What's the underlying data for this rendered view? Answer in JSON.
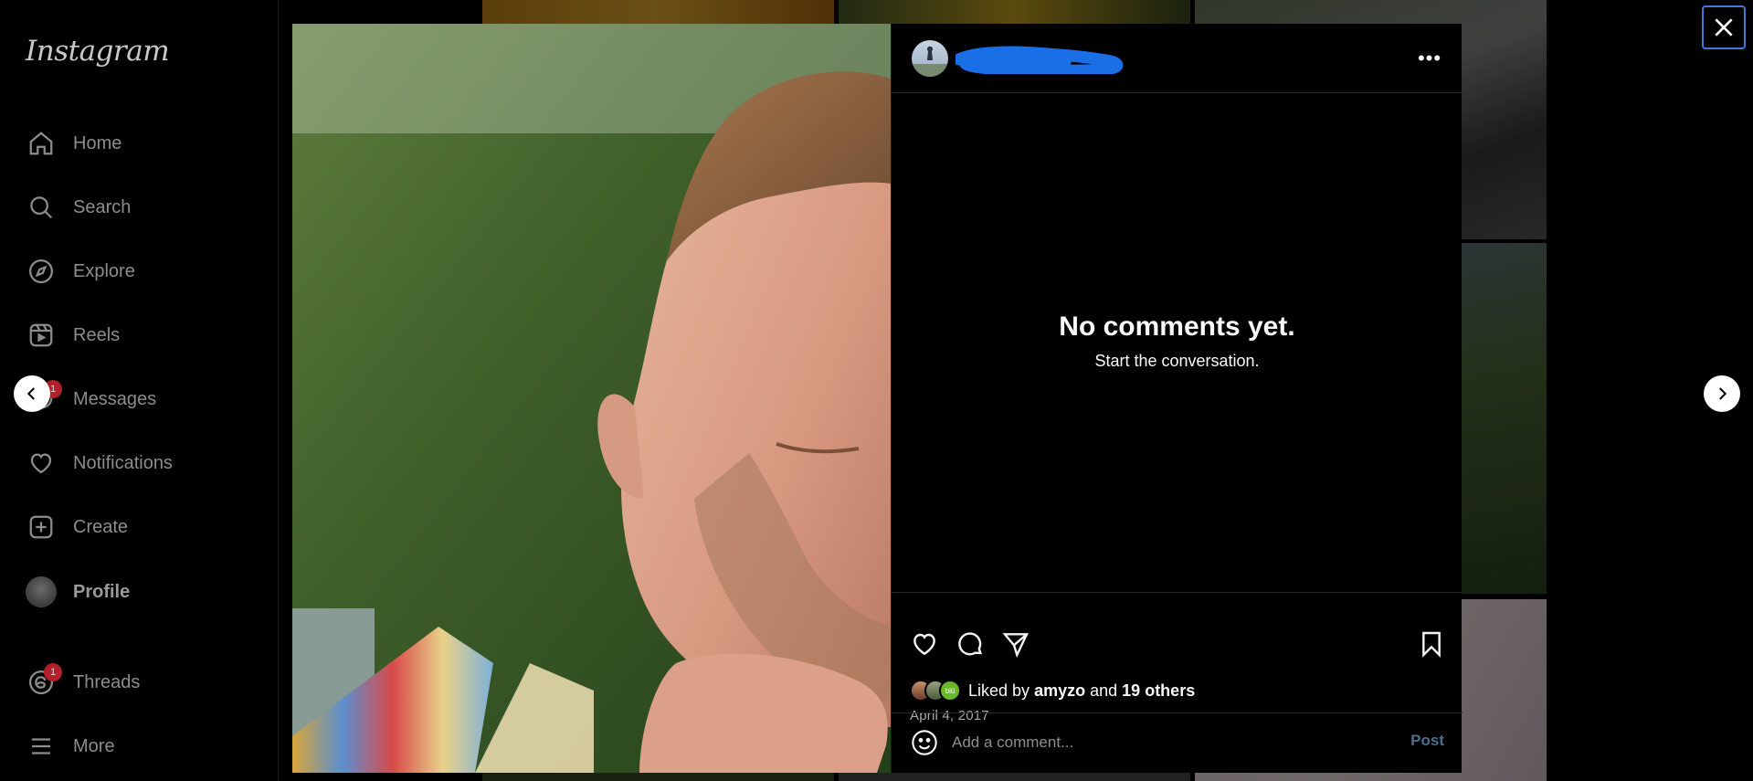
{
  "app": {
    "logo_text": "Instagram"
  },
  "sidebar": {
    "items": [
      {
        "label": "Home",
        "icon": "home-icon"
      },
      {
        "label": "Search",
        "icon": "search-icon"
      },
      {
        "label": "Explore",
        "icon": "compass-icon"
      },
      {
        "label": "Reels",
        "icon": "reels-icon"
      },
      {
        "label": "Messages",
        "icon": "messenger-icon",
        "badge": "1"
      },
      {
        "label": "Notifications",
        "icon": "heart-icon"
      },
      {
        "label": "Create",
        "icon": "plus-square-icon"
      },
      {
        "label": "Profile",
        "icon": "avatar"
      },
      {
        "label": "Threads",
        "icon": "threads-icon",
        "badge": "1"
      },
      {
        "label": "More",
        "icon": "menu-icon"
      }
    ]
  },
  "post": {
    "empty_title": "No comments yet.",
    "empty_subtitle": "Start the conversation.",
    "liked_by_prefix": "Liked by",
    "liked_by_user": "amyzo",
    "liked_by_connector": "and",
    "liked_by_others": "19 others",
    "date": "April 4, 2017",
    "liker_avatar_label": "blü"
  },
  "comment": {
    "placeholder": "Add a comment...",
    "post_label": "Post"
  },
  "colors": {
    "background": "#000000",
    "post_button": "#4b6d8c",
    "redaction": "#1a6ee6",
    "badge": "#b31f2b",
    "focus_ring": "#3d79d6"
  }
}
